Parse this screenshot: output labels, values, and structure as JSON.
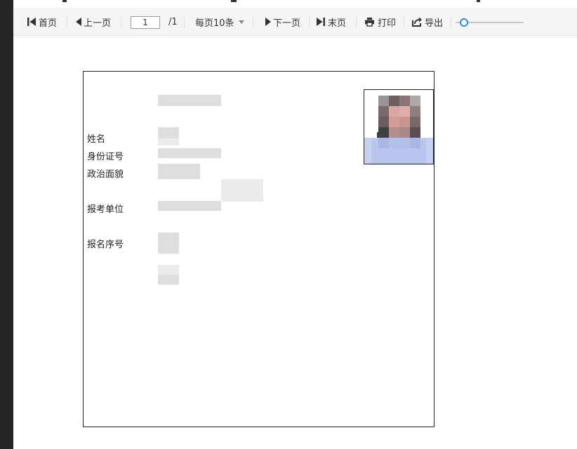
{
  "toolbar": {
    "first": "首页",
    "prev": "上一页",
    "page_value": "1",
    "total_pages": "/1",
    "page_size": "每页10条",
    "next": "下一页",
    "last": "末页",
    "print": "打印",
    "export": "导出"
  },
  "card": {
    "label_name": "姓名",
    "label_id": "身份证号",
    "label_political": "政治面貌",
    "label_unit": "报考单位",
    "label_reg_no": "报名序号"
  }
}
